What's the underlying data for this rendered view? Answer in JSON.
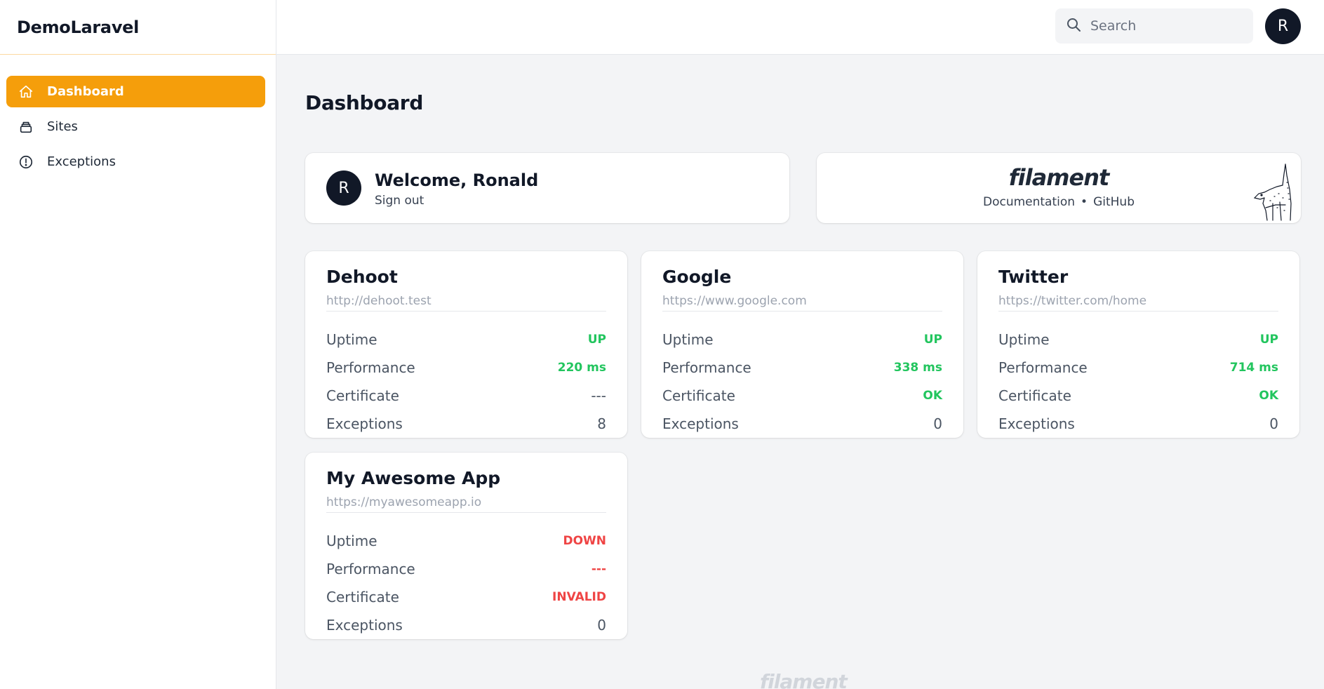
{
  "app": {
    "brand": "DemoLaravel"
  },
  "sidebar": {
    "items": [
      {
        "label": "Dashboard",
        "icon": "home-icon",
        "active": true
      },
      {
        "label": "Sites",
        "icon": "stack-icon",
        "active": false
      },
      {
        "label": "Exceptions",
        "icon": "alert-circle-icon",
        "active": false
      }
    ]
  },
  "topbar": {
    "search_placeholder": "Search",
    "avatar_initial": "R"
  },
  "page": {
    "title": "Dashboard"
  },
  "welcome": {
    "avatar_initial": "R",
    "title": "Welcome, Ronald",
    "signout": "Sign out"
  },
  "filament": {
    "logo": "filament",
    "docs": "Documentation",
    "separator": "•",
    "github": "GitHub"
  },
  "labels": {
    "uptime": "Uptime",
    "performance": "Performance",
    "certificate": "Certificate",
    "exceptions": "Exceptions"
  },
  "sites": [
    {
      "name": "Dehoot",
      "url": "http://dehoot.test",
      "uptime": "UP",
      "performance": "220 ms",
      "certificate": "---",
      "exceptions": "8"
    },
    {
      "name": "Google",
      "url": "https://www.google.com",
      "uptime": "UP",
      "performance": "338 ms",
      "certificate": "OK",
      "exceptions": "0"
    },
    {
      "name": "Twitter",
      "url": "https://twitter.com/home",
      "uptime": "UP",
      "performance": "714 ms",
      "certificate": "OK",
      "exceptions": "0"
    },
    {
      "name": "My Awesome App",
      "url": "https://myawesomeapp.io",
      "uptime": "DOWN",
      "performance": "---",
      "certificate": "INVALID",
      "exceptions": "0"
    }
  ],
  "footer": {
    "logo": "filament"
  },
  "colors": {
    "accent": "#f59e0b",
    "ok": "#22c55e",
    "error": "#ef4444"
  }
}
